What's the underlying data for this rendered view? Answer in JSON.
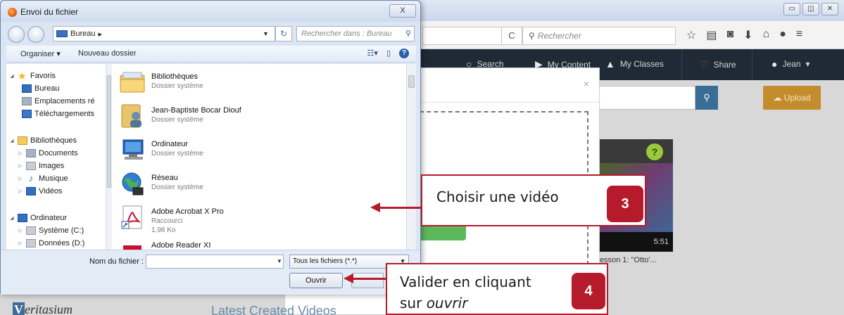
{
  "dialog": {
    "title": "Envoi du fichier",
    "close_label": "X",
    "breadcrumb": "Bureau",
    "breadcrumb_sep": "▸",
    "search_placeholder": "Rechercher dans : Bureau",
    "commands": {
      "organize": "Organiser ▾",
      "new_folder": "Nouveau dossier"
    },
    "favorites": {
      "label": "Favoris",
      "items": [
        "Bureau",
        "Emplacements ré",
        "Téléchargements"
      ]
    },
    "libraries": {
      "label": "Bibliothèques",
      "items": [
        "Documents",
        "Images",
        "Musique",
        "Vidéos"
      ]
    },
    "computer": {
      "label": "Ordinateur",
      "items": [
        "Système (C:)",
        "Données (D:)"
      ]
    },
    "files": [
      {
        "name": "Bibliothèques",
        "type": "Dossier système",
        "size": ""
      },
      {
        "name": "Jean-Baptiste Bocar Diouf",
        "type": "Dossier système",
        "size": ""
      },
      {
        "name": "Ordinateur",
        "type": "Dossier système",
        "size": ""
      },
      {
        "name": "Réseau",
        "type": "Dossier système",
        "size": ""
      },
      {
        "name": "Adobe Acrobat X Pro",
        "type": "Raccourci",
        "size": "1,98 Ko"
      },
      {
        "name": "Adobe Reader XI",
        "type": "",
        "size": ""
      }
    ],
    "filename_label": "Nom du fichier :",
    "filename_value": "",
    "filetype": "Tous les fichiers (*.*)",
    "open_label": "Ouvrir"
  },
  "browser": {
    "search_placeholder": "Rechercher",
    "reload_icon": "C"
  },
  "site": {
    "nav": {
      "search": "Search",
      "my_content": "My Content",
      "my_classes": "My Classes",
      "share": "Share",
      "user": "Jean"
    },
    "upload_label": "Upload",
    "video_duration": "5:51",
    "video_title": "esson 1: \"Otto'...",
    "thumb_badge": "?",
    "channel_prefix": "V",
    "channel_rest": "eritasium",
    "section_heading": "Latest Created Videos"
  },
  "callouts": [
    {
      "text": "Choisir une vidéo",
      "number": "3"
    },
    {
      "text_line1": "Valider en cliquant",
      "text_line2_prefix": "sur ",
      "text_line2_em": "ouvrir",
      "number": "4"
    }
  ],
  "colors": {
    "callout_red": "#b51b2a",
    "nav_bg": "#1e2a35",
    "upload_btn": "#c38d2e",
    "dialog_bg": "#dbe6f4"
  }
}
